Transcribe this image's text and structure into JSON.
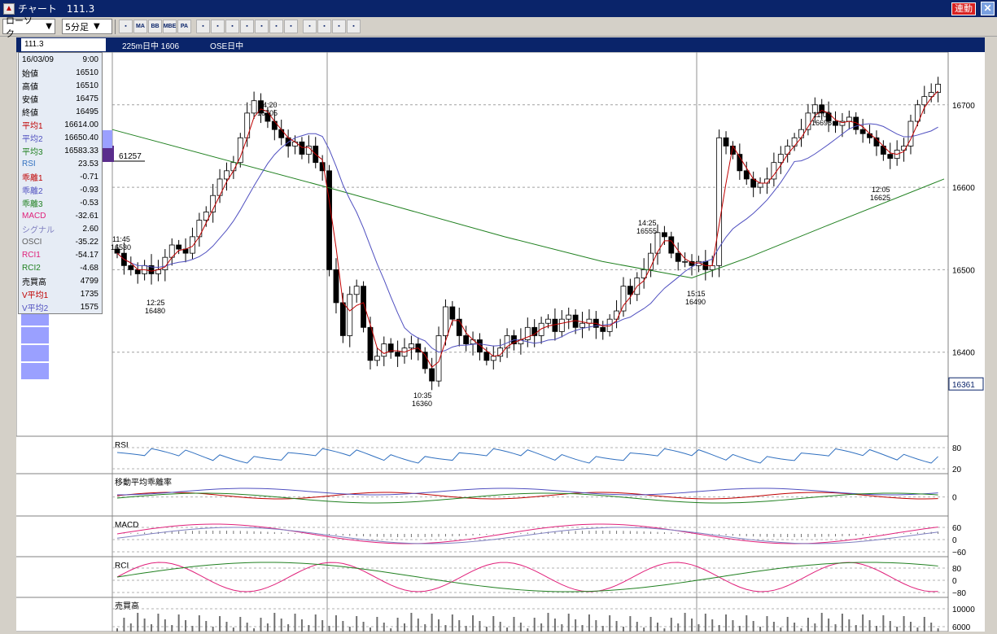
{
  "window": {
    "title": "チャート　111.3",
    "link_button": "連動",
    "close_icon": "close-icon",
    "app_icon": "chart-app-icon"
  },
  "toolbar": {
    "chart_type": "ローソク",
    "interval": "5分足",
    "tools": [
      "volume-chart-icon",
      "ma-icon",
      "bb-icon",
      "mbe-icon",
      "pa-icon",
      "line-chart-icon",
      "point-figure-icon",
      "trend-icon",
      "zoom-icon",
      "print-icon",
      "settings-icon",
      "draw-line-icon",
      "cursor-icon",
      "eraser-icon",
      "search-icon",
      "tool-icon"
    ],
    "tool_labels": [
      "",
      "MA",
      "BB",
      "MBE",
      "PA",
      "",
      "",
      "",
      "",
      "",
      "",
      "",
      "",
      "",
      "",
      ""
    ]
  },
  "infobar": {
    "code": "111.3",
    "symbol": "225m日中 1606",
    "market": "OSE日中"
  },
  "datapanel": [
    {
      "label": "16/03/09",
      "value": "9:00",
      "color": "#000000"
    },
    {
      "label": "始値",
      "value": "16510",
      "color": "#000000"
    },
    {
      "label": "高値",
      "value": "16510",
      "color": "#000000"
    },
    {
      "label": "安値",
      "value": "16475",
      "color": "#000000"
    },
    {
      "label": "終値",
      "value": "16495",
      "color": "#000000"
    },
    {
      "label": "平均1",
      "value": "16614.00",
      "color": "#c00000"
    },
    {
      "label": "平均2",
      "value": "16650.40",
      "color": "#5050c0"
    },
    {
      "label": "平均3",
      "value": "16583.33",
      "color": "#208020"
    },
    {
      "label": "RSI",
      "value": "23.53",
      "color": "#3070c0"
    },
    {
      "label": "乖離1",
      "value": "-0.71",
      "color": "#c00000"
    },
    {
      "label": "乖離2",
      "value": "-0.93",
      "color": "#5050c0"
    },
    {
      "label": "乖離3",
      "value": "-0.53",
      "color": "#208020"
    },
    {
      "label": "MACD",
      "value": "-32.61",
      "color": "#e0207a"
    },
    {
      "label": "シグナル",
      "value": "2.60",
      "color": "#8080c0"
    },
    {
      "label": "OSCI",
      "value": "-35.22",
      "color": "#606060"
    },
    {
      "label": "RCI1",
      "value": "-54.17",
      "color": "#e0207a"
    },
    {
      "label": "RCI2",
      "value": "-4.68",
      "color": "#208020"
    },
    {
      "label": "売買高",
      "value": "4799",
      "color": "#000000"
    },
    {
      "label": "V平均1",
      "value": "1735",
      "color": "#c00000"
    },
    {
      "label": "V平均2",
      "value": "1575",
      "color": "#5050c0"
    }
  ],
  "chart_data": {
    "type": "candlestick",
    "price_axis": {
      "ticks": [
        16700,
        16600,
        16500,
        16400
      ],
      "range": [
        16300,
        16760
      ],
      "current": "16361"
    },
    "volume_profile_label": "61257",
    "annotations": [
      {
        "time": "11:45",
        "price": "16530"
      },
      {
        "time": "12:25",
        "price": "16480"
      },
      {
        "time": "14:20",
        "price": "16705"
      },
      {
        "time": "10:35",
        "price": "16360"
      },
      {
        "time": "14:25",
        "price": "16555"
      },
      {
        "time": "15:15",
        "price": "16490"
      },
      {
        "time": "11:05",
        "price": "16695"
      },
      {
        "time": "12:05",
        "price": "16625"
      }
    ],
    "panes": [
      {
        "title": "RSI",
        "ticks": [
          "80",
          "20"
        ]
      },
      {
        "title": "移動平均乖離率",
        "ticks": [
          "0"
        ]
      },
      {
        "title": "MACD",
        "ticks": [
          "60",
          "0",
          "−60"
        ]
      },
      {
        "title": "RCI",
        "ticks": [
          "80",
          "0",
          "−80"
        ]
      },
      {
        "title": "売買高",
        "ticks": [
          "10000",
          "6000"
        ]
      }
    ],
    "closes": [
      16520,
      16505,
      16500,
      16495,
      16505,
      16495,
      16500,
      16515,
      16530,
      16525,
      16520,
      16540,
      16560,
      16570,
      16590,
      16610,
      16620,
      16630,
      16660,
      16690,
      16705,
      16690,
      16680,
      16670,
      16660,
      16650,
      16655,
      16640,
      16650,
      16630,
      16620,
      16500,
      16460,
      16420,
      16470,
      16480,
      16430,
      16390,
      16395,
      16410,
      16400,
      16395,
      16405,
      16410,
      16400,
      16380,
      16365,
      16420,
      16455,
      16440,
      16420,
      16410,
      16415,
      16400,
      16390,
      16395,
      16405,
      16420,
      16410,
      16415,
      16430,
      16420,
      16435,
      16440,
      16425,
      16440,
      16445,
      16430,
      16435,
      16440,
      16430,
      16425,
      16440,
      16450,
      16480,
      16470,
      16490,
      16500,
      16520,
      16545,
      16540,
      16520,
      16510,
      16510,
      16505,
      16510,
      16500,
      16505,
      16660,
      16650,
      16640,
      16620,
      16610,
      16600,
      16605,
      16610,
      16630,
      16640,
      16650,
      16660,
      16670,
      16690,
      16700,
      16690,
      16680,
      16675,
      16680,
      16685,
      16670,
      16665,
      16660,
      16650,
      16640,
      16635,
      16645,
      16650,
      16680,
      16700,
      16710,
      16715,
      16725
    ]
  }
}
